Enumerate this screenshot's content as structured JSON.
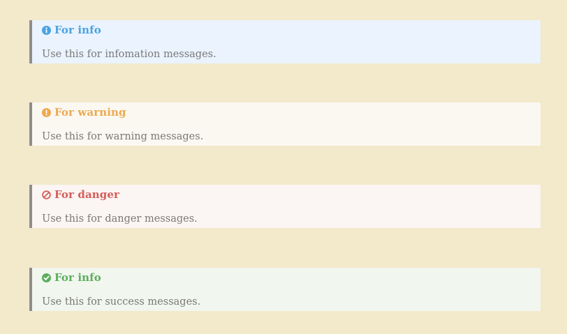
{
  "callouts": [
    {
      "title": "For info",
      "text": "Use this for infomation messages.",
      "icon": "info-circle",
      "color": "#4aa3df"
    },
    {
      "title": "For warning",
      "text": "Use this for warning messages.",
      "icon": "exclamation-circle",
      "color": "#eda951"
    },
    {
      "title": "For danger",
      "text": "Use this for danger messages.",
      "icon": "ban",
      "color": "#d55d5a"
    },
    {
      "title": "For info",
      "text": "Use this for success messages.",
      "icon": "check-circle",
      "color": "#5cae5c"
    }
  ]
}
